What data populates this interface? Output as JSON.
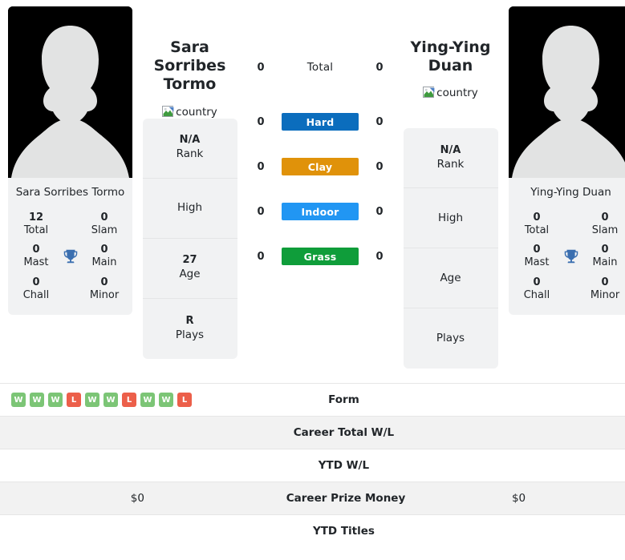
{
  "players": [
    {
      "name": "Sara Sorribes Tormo",
      "card_name": "Sara Sorribes Tormo",
      "country_alt": "country",
      "titles": {
        "total": "12",
        "total_label": "Total",
        "slam": "0",
        "slam_label": "Slam",
        "mast": "0",
        "mast_label": "Mast",
        "main": "0",
        "main_label": "Main",
        "chall": "0",
        "chall_label": "Chall",
        "minor": "0",
        "minor_label": "Minor"
      },
      "info": {
        "rank_value": "N/A",
        "rank_label": "Rank",
        "high_value": "",
        "high_label": "High",
        "age_value": "27",
        "age_label": "Age",
        "plays_value": "R",
        "plays_label": "Plays"
      },
      "surfaces": {
        "total": "0",
        "hard": "0",
        "clay": "0",
        "indoor": "0",
        "grass": "0"
      }
    },
    {
      "name": "Ying-Ying Duan",
      "card_name": "Ying-Ying Duan",
      "country_alt": "country",
      "titles": {
        "total": "0",
        "total_label": "Total",
        "slam": "0",
        "slam_label": "Slam",
        "mast": "0",
        "mast_label": "Mast",
        "main": "0",
        "main_label": "Main",
        "chall": "0",
        "chall_label": "Chall",
        "minor": "0",
        "minor_label": "Minor"
      },
      "info": {
        "rank_value": "N/A",
        "rank_label": "Rank",
        "high_value": "",
        "high_label": "High",
        "age_value": "",
        "age_label": "Age",
        "plays_value": "",
        "plays_label": "Plays"
      },
      "surfaces": {
        "total": "0",
        "hard": "0",
        "clay": "0",
        "indoor": "0",
        "grass": "0"
      }
    }
  ],
  "surface_labels": {
    "total": "Total",
    "hard": "Hard",
    "clay": "Clay",
    "indoor": "Indoor",
    "grass": "Grass"
  },
  "surface_colors": {
    "hard": "#0b6dbd",
    "clay": "#e0920a",
    "indoor": "#2196f3",
    "grass": "#0f9d3a"
  },
  "icons": {
    "trophy": "trophy-icon",
    "broken_image": "broken-image-icon"
  },
  "accent": {
    "trophy_blue": "#3b6fb0",
    "win_green": "#7cc576",
    "loss_red": "#ec5f4a",
    "card_bg": "#f1f2f3"
  },
  "comparison_rows": [
    {
      "label": "Form",
      "left_form": [
        "W",
        "W",
        "W",
        "L",
        "W",
        "W",
        "L",
        "W",
        "W",
        "L"
      ],
      "left": "",
      "right": "",
      "right_form": [],
      "striped": false
    },
    {
      "label": "Career Total W/L",
      "left": "",
      "right": "",
      "striped": true
    },
    {
      "label": "YTD W/L",
      "left": "",
      "right": "",
      "striped": false
    },
    {
      "label": "Career Prize Money",
      "left": "$0",
      "right": "$0",
      "striped": true
    },
    {
      "label": "YTD Titles",
      "left": "",
      "right": "",
      "striped": false
    }
  ]
}
